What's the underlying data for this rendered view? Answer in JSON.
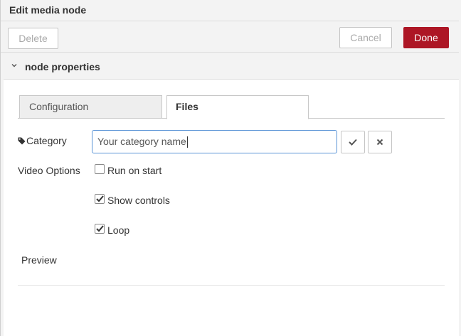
{
  "header": {
    "title": "Edit media node"
  },
  "buttons": {
    "delete_label": "Delete",
    "cancel_label": "Cancel",
    "done_label": "Done"
  },
  "section": {
    "title": "node properties",
    "expanded": true
  },
  "tabs": [
    {
      "label": "Configuration",
      "active": false
    },
    {
      "label": "Files",
      "active": true
    }
  ],
  "form": {
    "category_label": "Category",
    "category_value": "Your category name",
    "video_options_label": "Video Options",
    "options": [
      {
        "label": "Run on start",
        "checked": false
      },
      {
        "label": "Show controls",
        "checked": true
      },
      {
        "label": "Loop",
        "checked": true
      }
    ],
    "preview_label": "Preview"
  },
  "colors": {
    "done_button": "#ad1625",
    "input_focus_border": "#5a94d6"
  },
  "icons": {
    "chevron": "chevron-down-icon",
    "tag": "tag-icon",
    "confirm": "check-icon",
    "clear": "close-icon"
  }
}
